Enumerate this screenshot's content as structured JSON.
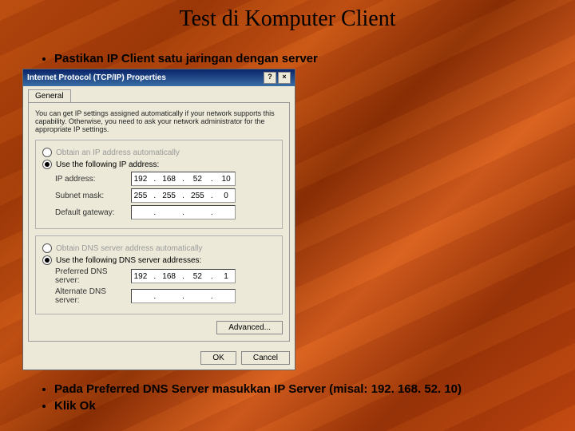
{
  "slide": {
    "title": "Test di Komputer Client",
    "bullet1": "Pastikan IP Client satu jaringan dengan server",
    "bullet2": "Pada Preferred DNS Server masukkan IP Server (misal: 192. 168. 52. 10)",
    "bullet3": "Klik Ok"
  },
  "dialog": {
    "title": "Internet Protocol (TCP/IP) Properties",
    "help": "?",
    "close": "×",
    "tab": "General",
    "description": "You can get IP settings assigned automatically if your network supports this capability. Otherwise, you need to ask your network administrator for the appropriate IP settings.",
    "ip": {
      "radio_auto": "Obtain an IP address automatically",
      "radio_manual": "Use the following IP address:",
      "label_ip": "IP address:",
      "label_mask": "Subnet mask:",
      "label_gw": "Default gateway:",
      "ip_o1": "192",
      "ip_o2": "168",
      "ip_o3": "52",
      "ip_o4": "10",
      "mask_o1": "255",
      "mask_o2": "255",
      "mask_o3": "255",
      "mask_o4": "0",
      "gw_o1": "",
      "gw_o2": "",
      "gw_o3": "",
      "gw_o4": ""
    },
    "dns": {
      "radio_auto": "Obtain DNS server address automatically",
      "radio_manual": "Use the following DNS server addresses:",
      "label_pref": "Preferred DNS server:",
      "label_alt": "Alternate DNS server:",
      "pref_o1": "192",
      "pref_o2": "168",
      "pref_o3": "52",
      "pref_o4": "1",
      "alt_o1": "",
      "alt_o2": "",
      "alt_o3": "",
      "alt_o4": ""
    },
    "advanced": "Advanced...",
    "ok": "OK",
    "cancel": "Cancel"
  }
}
